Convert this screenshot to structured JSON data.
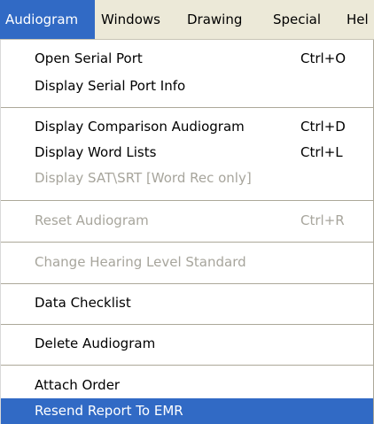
{
  "menubar": {
    "items": [
      {
        "label": "Audiogram"
      },
      {
        "label": "Windows"
      },
      {
        "label": "Drawing"
      },
      {
        "label": "Special"
      },
      {
        "label": "Hel"
      }
    ]
  },
  "menu": {
    "items": [
      {
        "label": "Open Serial Port",
        "shortcut": "Ctrl+O",
        "enabled": true
      },
      {
        "label": "Display Serial Port Info",
        "enabled": true
      },
      {
        "label": "Display Comparison Audiogram",
        "shortcut": "Ctrl+D",
        "enabled": true
      },
      {
        "label": "Display Word Lists",
        "shortcut": "Ctrl+L",
        "enabled": true
      },
      {
        "label": "Display SAT\\SRT [Word Rec only]",
        "enabled": false
      },
      {
        "label": "Reset Audiogram",
        "shortcut": "Ctrl+R",
        "enabled": false
      },
      {
        "label": "Change Hearing Level Standard",
        "enabled": false
      },
      {
        "label": "Data Checklist",
        "enabled": true
      },
      {
        "label": "Delete Audiogram",
        "enabled": true
      },
      {
        "label": "Attach Order",
        "enabled": true
      },
      {
        "label": "Resend Report To EMR",
        "enabled": true,
        "highlighted": true
      }
    ]
  },
  "colors": {
    "menubar_bg": "#ece9d8",
    "highlight": "#316ac5",
    "disabled_text": "#a7a59c"
  }
}
